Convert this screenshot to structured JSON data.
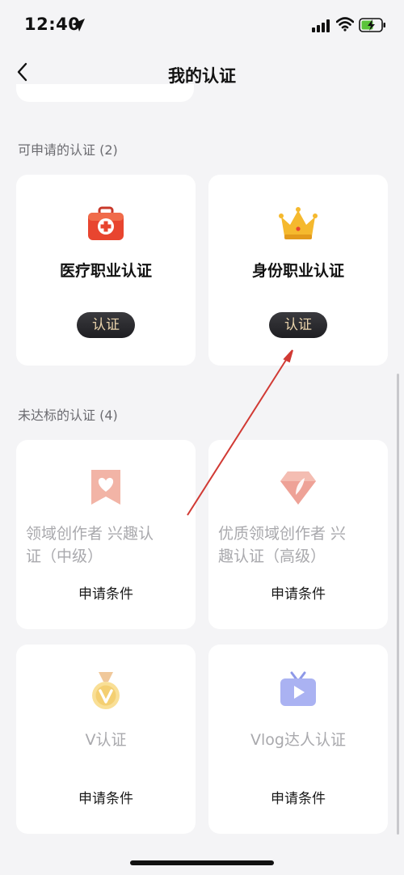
{
  "status": {
    "time": "12:40"
  },
  "nav": {
    "title": "我的认证"
  },
  "sections": {
    "available": {
      "title": "可申请的认证 (2)",
      "cards": [
        {
          "title": "医疗职业认证",
          "button": "认证"
        },
        {
          "title": "身份职业认证",
          "button": "认证"
        }
      ]
    },
    "unqualified": {
      "title": "未达标的认证 (4)",
      "cards": [
        {
          "title_line1": "领域创作者 兴趣认",
          "title_line2": "证（中级）",
          "action": "申请条件"
        },
        {
          "title_line1": "优质领域创作者 兴",
          "title_line2": "趣认证（高级）",
          "action": "申请条件"
        },
        {
          "title": "V认证",
          "action": "申请条件"
        },
        {
          "title": "Vlog达人认证",
          "action": "申请条件"
        }
      ]
    }
  },
  "colors": {
    "accent_red": "#e8452f",
    "crown_gold": "#f5b92e",
    "pill_text": "#e9d3ac",
    "annotation_arrow": "#d13a34"
  },
  "icons": [
    "medical-kit-icon",
    "crown-icon",
    "heart-ribbon-icon",
    "feather-gem-icon",
    "v-medal-icon",
    "video-tv-icon"
  ]
}
